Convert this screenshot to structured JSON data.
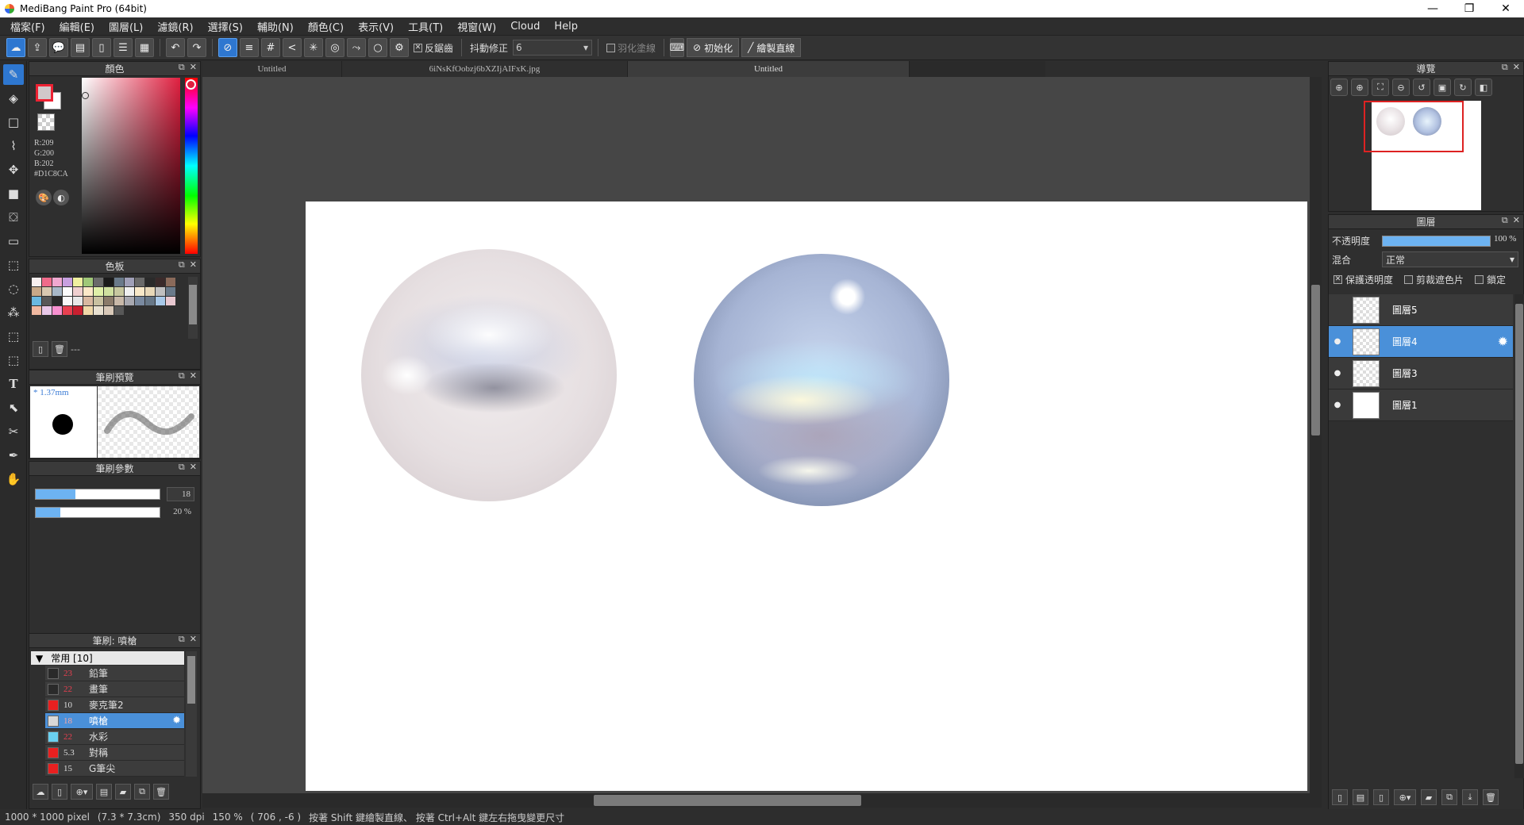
{
  "window": {
    "title": "MediBang Paint Pro (64bit)",
    "min": "—",
    "max": "❐",
    "close": "✕"
  },
  "menu": [
    "檔案(F)",
    "編輯(E)",
    "圖層(L)",
    "濾鏡(R)",
    "選擇(S)",
    "輔助(N)",
    "顏色(C)",
    "表示(V)",
    "工具(T)",
    "視窗(W)",
    "Cloud",
    "Help"
  ],
  "toolbar": {
    "antialias": "反鋸齒",
    "stabilizer_label": "抖動修正",
    "stabilizer_value": "6",
    "feather": "羽化塗線",
    "init_button": "初始化",
    "draw_line_button": "繪製直線"
  },
  "color_panel": {
    "title": "顏色",
    "r": "R:209",
    "g": "G:200",
    "b": "B:202",
    "hex": "#D1C8CA",
    "fg_color": "#D1C8CA"
  },
  "palette_panel": {
    "title": "色板",
    "empty_label": "---",
    "swatches": [
      "#f8f0f0",
      "#f06a8a",
      "#f0a8d0",
      "#c8a0e0",
      "#f0f0a0",
      "#a0c878",
      "#6a6a6a",
      "#1a1a1a",
      "#6a7a8a",
      "#a0a0b8",
      "#6a6a6a",
      "#2a2a2a",
      "#3a2a2a",
      "#8a6a5a",
      "#c8a888",
      "#d8c8b0",
      "#a8b8c8",
      "#fcfcfc",
      "#f0d0d0",
      "#fce8c8",
      "#e0f0a8",
      "#d0e0a0",
      "#c8c8a0",
      "#f0f0f0",
      "#f8e8c8",
      "#e8d8b8",
      "#c0c0c0",
      "#6a7a8a",
      "#6ab8e0",
      "#585858",
      "#2a2a2a",
      "#f8f8f8",
      "#e8e8e8",
      "#d8b8a0",
      "#c8c0a0",
      "#8a7a6a",
      "#c8b8a8",
      "#a8a8b0",
      "#7a8aa0",
      "#687888",
      "#a8c8e8",
      "#e8c8d0",
      "#f0b8a0",
      "#e8c8e8",
      "#f890d0",
      "#e84050",
      "#c82030",
      "#f0d8a8",
      "#e8e0d0",
      "#d8c8b8",
      "#585858"
    ]
  },
  "brush_preview": {
    "title": "筆刷預覽",
    "size": "* 1.37mm"
  },
  "brush_params": {
    "title": "筆刷參數",
    "size_value": "18",
    "opacity_value": "20 %",
    "size_fraction": 0.32,
    "opacity_fraction": 0.2
  },
  "brush_list": {
    "title": "筆刷: 噴槍",
    "group": "常用 [10]",
    "items": [
      {
        "num": "23",
        "name": "鉛筆",
        "color": "#2a2a2a",
        "numcolor": "#e84050"
      },
      {
        "num": "22",
        "name": "畫筆",
        "color": "#2a2a2a",
        "numcolor": "#e84050"
      },
      {
        "num": "10",
        "name": "麥克筆2",
        "color": "#e82020",
        "numcolor": "#ddd"
      },
      {
        "num": "18",
        "name": "噴槍",
        "color": "#d8d8d8",
        "numcolor": "#f5a8a8"
      },
      {
        "num": "22",
        "name": "水彩",
        "color": "#6ad0f0",
        "numcolor": "#e84050"
      },
      {
        "num": "5.3",
        "name": "對稱",
        "color": "#e82020",
        "numcolor": "#ddd"
      },
      {
        "num": "15",
        "name": "G筆尖",
        "color": "#e82020",
        "numcolor": "#ddd"
      }
    ]
  },
  "tabs": [
    "Untitled",
    "6iNsKfOobzj6bXZIjAIFxK.jpg",
    "Untitled"
  ],
  "navigator": {
    "title": "導覽"
  },
  "layers": {
    "title": "圖層",
    "opacity_label": "不透明度",
    "opacity_value": "100 %",
    "blend_label": "混合",
    "blend_value": "正常",
    "protect_alpha": "保護透明度",
    "clipping": "剪裁遮色片",
    "lock": "鎖定",
    "items": [
      {
        "name": "圖層5",
        "selected": false,
        "visible": false,
        "transparent": true
      },
      {
        "name": "圖層4",
        "selected": true,
        "visible": true,
        "transparent": true
      },
      {
        "name": "圖層3",
        "selected": false,
        "visible": true,
        "transparent": true
      },
      {
        "name": "圖層1",
        "selected": false,
        "visible": true,
        "transparent": false
      }
    ]
  },
  "status": {
    "size": "1000 * 1000 pixel",
    "cm": "(7.3 * 7.3cm)",
    "dpi": "350 dpi",
    "zoom": "150 %",
    "coords": "( 706 , -6 )",
    "hint": "按著 Shift 鍵繪製直線、 按著 Ctrl+Alt 鍵左右拖曳變更尺寸"
  }
}
